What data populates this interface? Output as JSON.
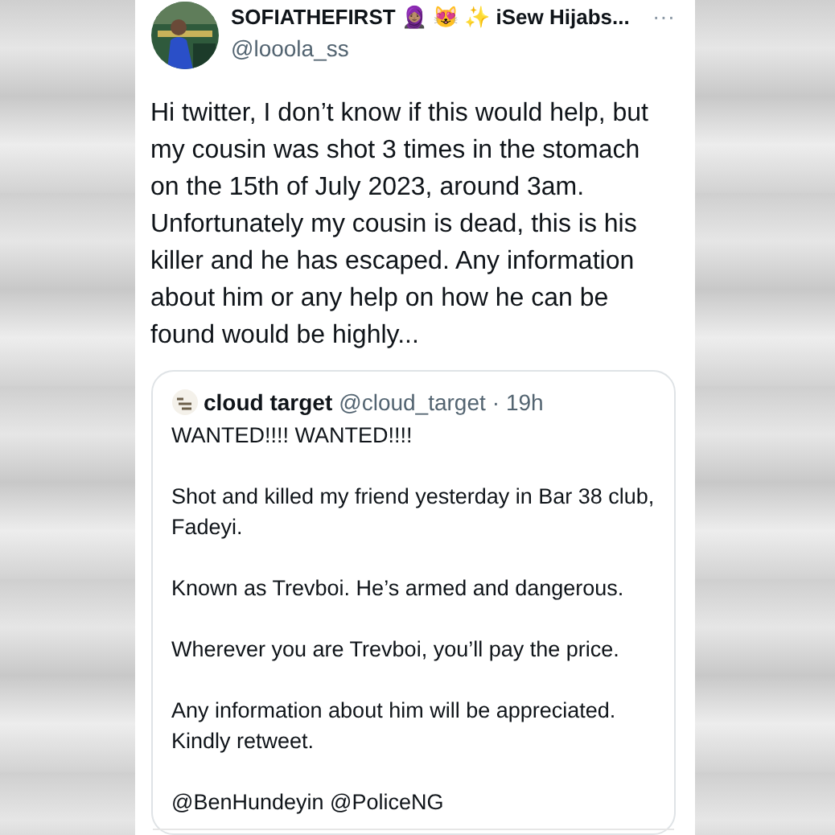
{
  "tweet": {
    "display_name": "SOFIATHEFIRST 🧕🏽 😻 ✨ iSew Hijabs...",
    "handle": "@looola_ss",
    "more": "···",
    "text": "Hi twitter, I don’t know if this would help, but my cousin was shot 3 times in the stomach on the 15th of July 2023, around 3am. Unfortunately my cousin is dead, this is his killer and he has escaped. Any information about him or any help on how he can be found would be highly...",
    "quote": {
      "display_name": "cloud target",
      "handle": "@cloud_target",
      "time": "· 19h",
      "paragraphs": [
        "WANTED!!!! WANTED!!!!",
        "Shot and killed my friend yesterday in Bar 38 club, Fadeyi.",
        "Known as Trevboi. He’s armed and dangerous.",
        "Wherever you are Trevboi, you’ll pay the price.",
        "Any information about him will be appreciated. Kindly retweet.",
        "@BenHundeyin @PoliceNG"
      ]
    }
  }
}
